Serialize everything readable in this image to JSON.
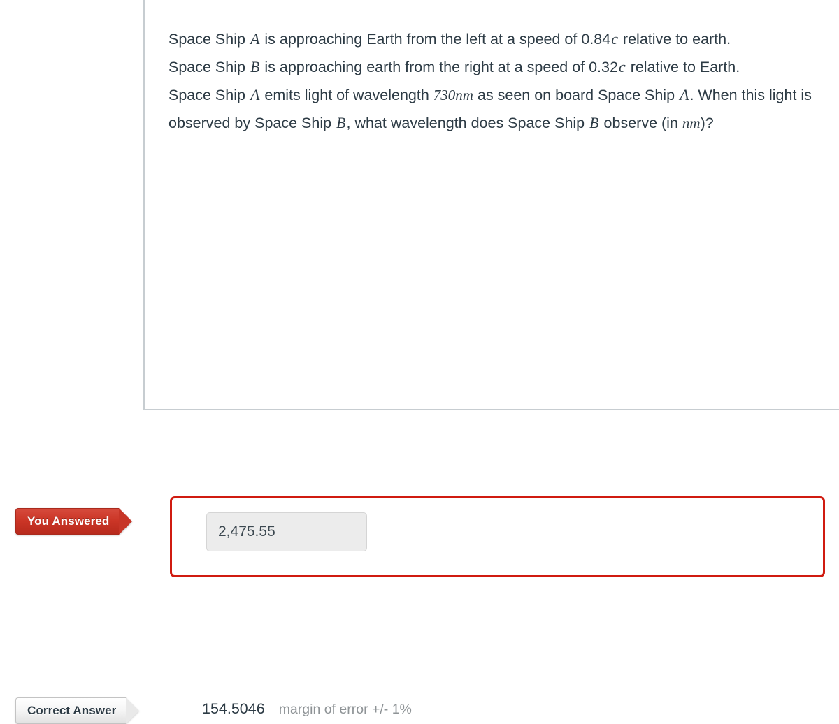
{
  "question": {
    "lines": [
      {
        "segments": [
          {
            "text": "Space Ship ",
            "style": "normal"
          },
          {
            "text": "A",
            "style": "math"
          },
          {
            "text": " is approaching Earth from the left at a speed of 0.84",
            "style": "normal"
          },
          {
            "text": "c",
            "style": "math"
          },
          {
            "text": " relative to earth.",
            "style": "normal"
          }
        ]
      },
      {
        "segments": [
          {
            "text": "Space Ship ",
            "style": "normal"
          },
          {
            "text": "B",
            "style": "math"
          },
          {
            "text": " is approaching earth from the right at a speed of 0.32",
            "style": "normal"
          },
          {
            "text": "c",
            "style": "math"
          },
          {
            "text": " relative to Earth.",
            "style": "normal"
          }
        ]
      },
      {
        "segments": [
          {
            "text": "Space Ship ",
            "style": "normal"
          },
          {
            "text": "A",
            "style": "math"
          },
          {
            "text": " emits light of wavelength  ",
            "style": "normal"
          },
          {
            "text": "730nm",
            "style": "mathunit"
          },
          {
            "text": " as seen on board Space Ship ",
            "style": "normal"
          },
          {
            "text": "A",
            "style": "math"
          },
          {
            "text": ". When this light is observed by Space Ship ",
            "style": "normal"
          },
          {
            "text": "B",
            "style": "math"
          },
          {
            "text": ", what wavelength does Space Ship ",
            "style": "normal"
          },
          {
            "text": "B",
            "style": "math"
          },
          {
            "text": " observe  (in ",
            "style": "normal"
          },
          {
            "text": "nm",
            "style": "mathunit"
          },
          {
            "text": ")?",
            "style": "normal"
          }
        ]
      }
    ]
  },
  "your_answer": {
    "flag_label": "You Answered",
    "value": "2,475.55",
    "flag_color": "#c73527",
    "box_border_color": "#d01b10"
  },
  "correct_answer": {
    "flag_label": "Correct Answer",
    "value": "154.5046",
    "margin_of_error": "margin of error +/- 1%",
    "flag_color": "#e9e9e9"
  }
}
